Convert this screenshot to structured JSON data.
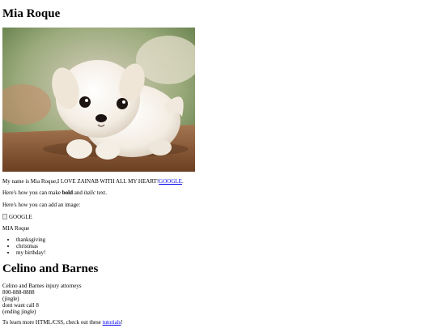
{
  "heading_main": "Mia Roque",
  "photo": {
    "alt": "puppy photo",
    "icon": "puppy-photo"
  },
  "intro": {
    "text": "My name is Mia Roque,I LOVE ZAINAB WITH ALL MY HEART!",
    "link": "GOOGLE",
    "after": "."
  },
  "formatting": {
    "before": "Here's how you can make ",
    "bold": "bold",
    "middle": " and ",
    "italic": "italic",
    "after": " text."
  },
  "image_howto": "Here's how you can add an image:",
  "broken_image_alt": "GOOGLE",
  "name_line": "MIA Roque",
  "list_items": [
    "thanksgiving",
    "christmas",
    "my birthday!"
  ],
  "heading_second": "Celino and Barnes",
  "ad_lines": [
    "Celino and Barnes injury attorneys",
    "800-888-8888",
    "(jingle)",
    "dont want call 8",
    "(ending jingle)"
  ],
  "footer": {
    "before": "To learn more HTML/CSS, check out these ",
    "link": "tutorials",
    "after": "!"
  }
}
